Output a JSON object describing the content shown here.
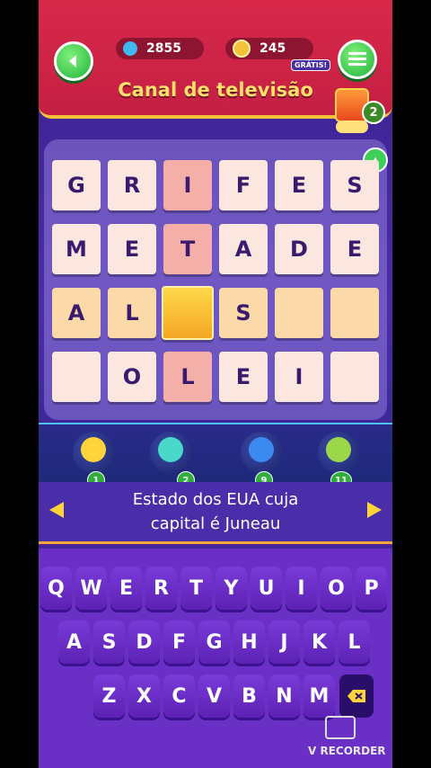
{
  "header": {
    "gems": "2855",
    "coins": "245",
    "free_label": "GRÁTIS!",
    "category_title": "Canal de televisão",
    "gift_count": "2"
  },
  "board": {
    "rows": [
      [
        "G",
        "R",
        "I",
        "F",
        "E",
        "S"
      ],
      [
        "M",
        "E",
        "T",
        "A",
        "D",
        "E"
      ],
      [
        "A",
        "L",
        "",
        "S",
        "",
        ""
      ],
      [
        "",
        "O",
        "L",
        "E",
        "I",
        ""
      ]
    ]
  },
  "helpers": [
    {
      "name": "bee-helper",
      "count": "1"
    },
    {
      "name": "bird-helper",
      "count": "2"
    },
    {
      "name": "robot-helper",
      "count": "9"
    },
    {
      "name": "alien-helper",
      "count": "11"
    }
  ],
  "clue": {
    "text_line1": "Estado dos EUA cuja",
    "text_line2": "capital é Juneau"
  },
  "keyboard": {
    "row1": [
      "Q",
      "W",
      "E",
      "R",
      "T",
      "Y",
      "U",
      "I",
      "O",
      "P"
    ],
    "row2": [
      "A",
      "S",
      "D",
      "F",
      "G",
      "H",
      "J",
      "K",
      "L"
    ],
    "row3": [
      "Z",
      "X",
      "C",
      "V",
      "B",
      "N",
      "M"
    ]
  },
  "watermark": "V RECORDER"
}
